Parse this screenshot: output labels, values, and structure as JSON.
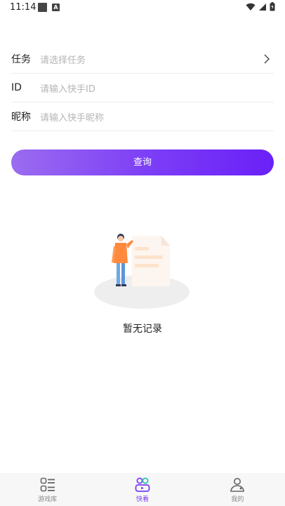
{
  "status": {
    "time": "11:14",
    "a_icon": "A"
  },
  "form": {
    "task": {
      "label": "任务",
      "placeholder": "请选择任务"
    },
    "id": {
      "label": "ID",
      "placeholder": "请输入快手ID"
    },
    "nickname": {
      "label": "昵称",
      "placeholder": "请输入快手昵称"
    }
  },
  "query_button": "查询",
  "empty": {
    "text": "暂无记录"
  },
  "tabs": [
    {
      "label": "游戏库",
      "icon": "list-icon",
      "active": false
    },
    {
      "label": "快看",
      "icon": "glasses-icon",
      "active": true
    },
    {
      "label": "我的",
      "icon": "user-icon",
      "active": false
    }
  ],
  "colors": {
    "accent": "#7b3cf6",
    "gradient_start": "#9b6cf0",
    "gradient_end": "#6a20f7"
  }
}
